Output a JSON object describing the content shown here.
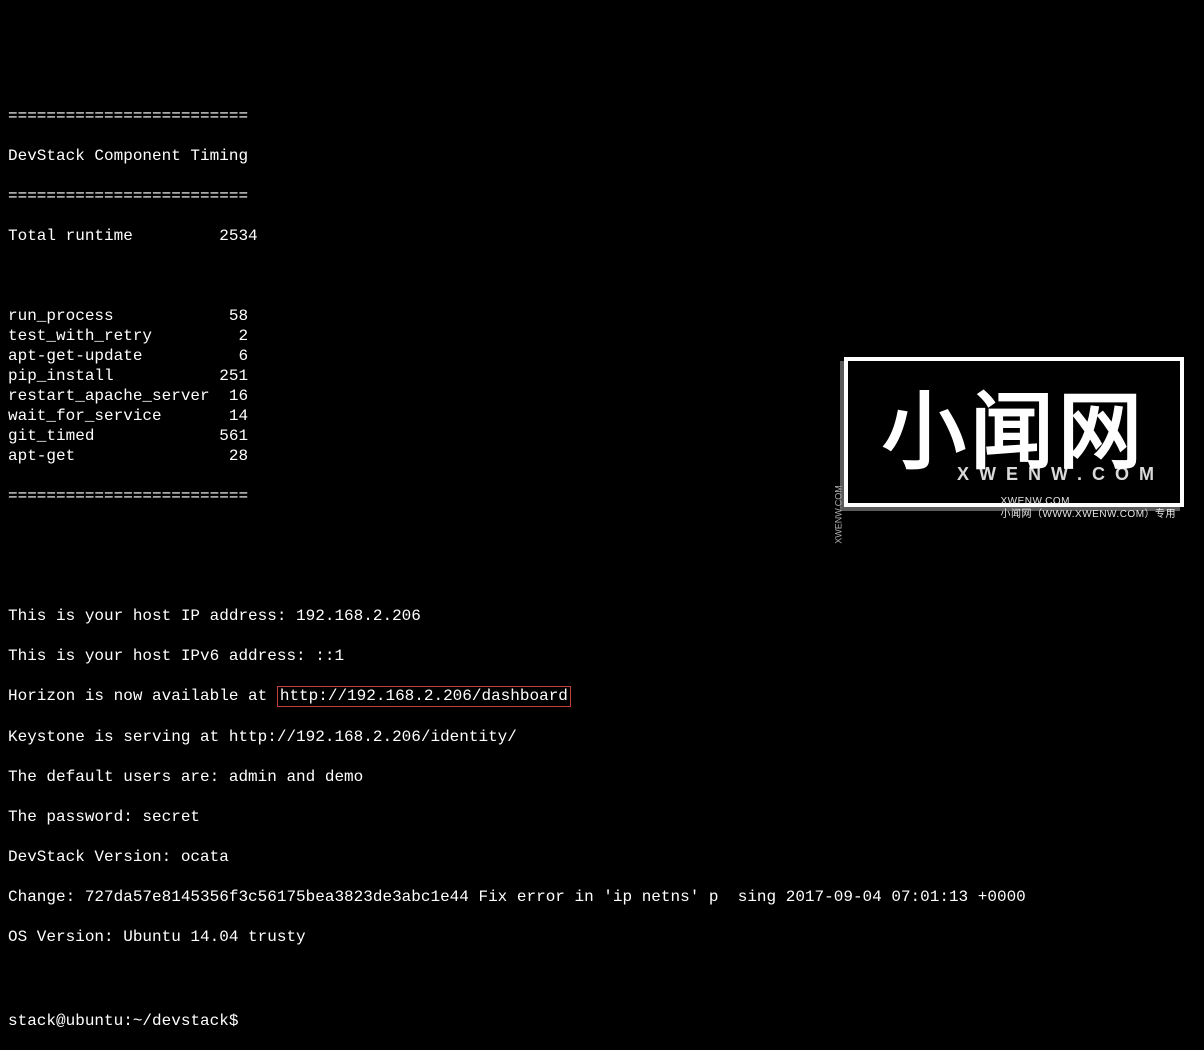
{
  "separator": "=========================",
  "timing_header": "DevStack Component Timing",
  "total_label": "Total runtime",
  "total_value": "2534",
  "timing_rows": [
    {
      "name": "run_process",
      "value": "58"
    },
    {
      "name": "test_with_retry",
      "value": "2"
    },
    {
      "name": "apt-get-update",
      "value": "6"
    },
    {
      "name": "pip_install",
      "value": "251"
    },
    {
      "name": "restart_apache_server",
      "value": "16"
    },
    {
      "name": "wait_for_service",
      "value": "14"
    },
    {
      "name": "git_timed",
      "value": "561"
    },
    {
      "name": "apt-get",
      "value": "28"
    }
  ],
  "msg": {
    "host_ip": "This is your host IP address: 192.168.2.206",
    "host_ipv6": "This is your host IPv6 address: ::1",
    "horizon_prefix": "Horizon is now available at ",
    "horizon_url": "http://192.168.2.206/dashboard",
    "keystone": "Keystone is serving at http://192.168.2.206/identity/",
    "users": "The default users are: admin and demo",
    "password": "The password: secret",
    "version": "DevStack Version: ocata",
    "change": "Change: 727da57e8145356f3c56175bea3823de3abc1e44 Fix error in 'ip netns' p  sing 2017-09-04 07:01:13 +0000",
    "os": "OS Version: Ubuntu 14.04 trusty"
  },
  "prompt": {
    "user_host": "stack@ubuntu",
    "sep1": ":",
    "path": "~/devstack",
    "sep2": "$"
  },
  "watermark": {
    "main": "小闻网",
    "mid": "XWENW.COM",
    "side": "XWENW.COM",
    "sub_left": "XWENW.COM",
    "sub_right": "小闻网（WWW.XWENW.COM）专用"
  }
}
